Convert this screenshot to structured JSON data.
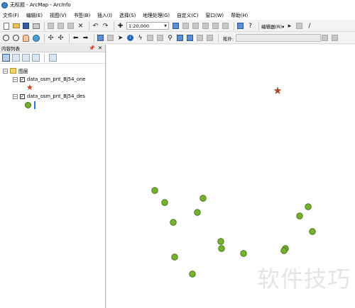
{
  "window": {
    "title": "无标题 - ArcMap - ArcInfo"
  },
  "menu": [
    "文件(F)",
    "编辑(E)",
    "视图(V)",
    "书签(B)",
    "插入(I)",
    "选择(S)",
    "地理处理(G)",
    "自定义(C)",
    "窗口(W)",
    "帮助(H)"
  ],
  "toolbar": {
    "scale": "1:20,000",
    "editor_label": "编辑器(R)▾",
    "topology_label": "拓扑:"
  },
  "toc": {
    "title": "内容列表",
    "pin": "📌",
    "close": "✕",
    "root": "图层",
    "layers": [
      {
        "name": "data_osm_pnt_BJ54_one",
        "checked": true,
        "symbol": "star"
      },
      {
        "name": "data_osm_pnt_BJ54_des",
        "checked": true,
        "symbol": "dot"
      }
    ]
  },
  "map": {
    "star_color": "#c4401a",
    "dot_color": "#76b12d",
    "watermark": "软件技巧"
  }
}
